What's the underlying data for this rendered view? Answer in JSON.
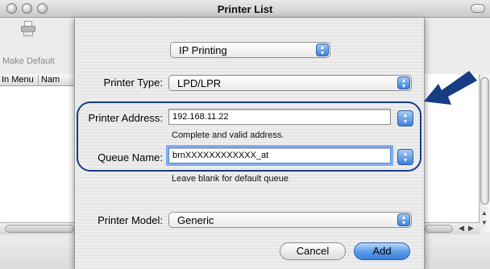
{
  "window": {
    "title": "Printer List"
  },
  "toolbar": {
    "make_default_label": "Make Default"
  },
  "list": {
    "columns": [
      "In Menu",
      "Nam"
    ]
  },
  "sheet": {
    "protocol_popup": "IP Printing",
    "printer_type_label": "Printer Type:",
    "printer_type_value": "LPD/LPR",
    "printer_address_label": "Printer Address:",
    "printer_address_value": "192.168.11.22",
    "address_hint": "Complete and valid address.",
    "queue_name_label": "Queue Name:",
    "queue_name_value": "brnXXXXXXXXXXXX_at",
    "queue_hint": "Leave blank for default queue",
    "printer_model_label": "Printer Model:",
    "printer_model_value": "Generic",
    "cancel_label": "Cancel",
    "add_label": "Add"
  },
  "colors": {
    "accent_blue": "#3e7fd8",
    "annotation_navy": "#183c84"
  }
}
